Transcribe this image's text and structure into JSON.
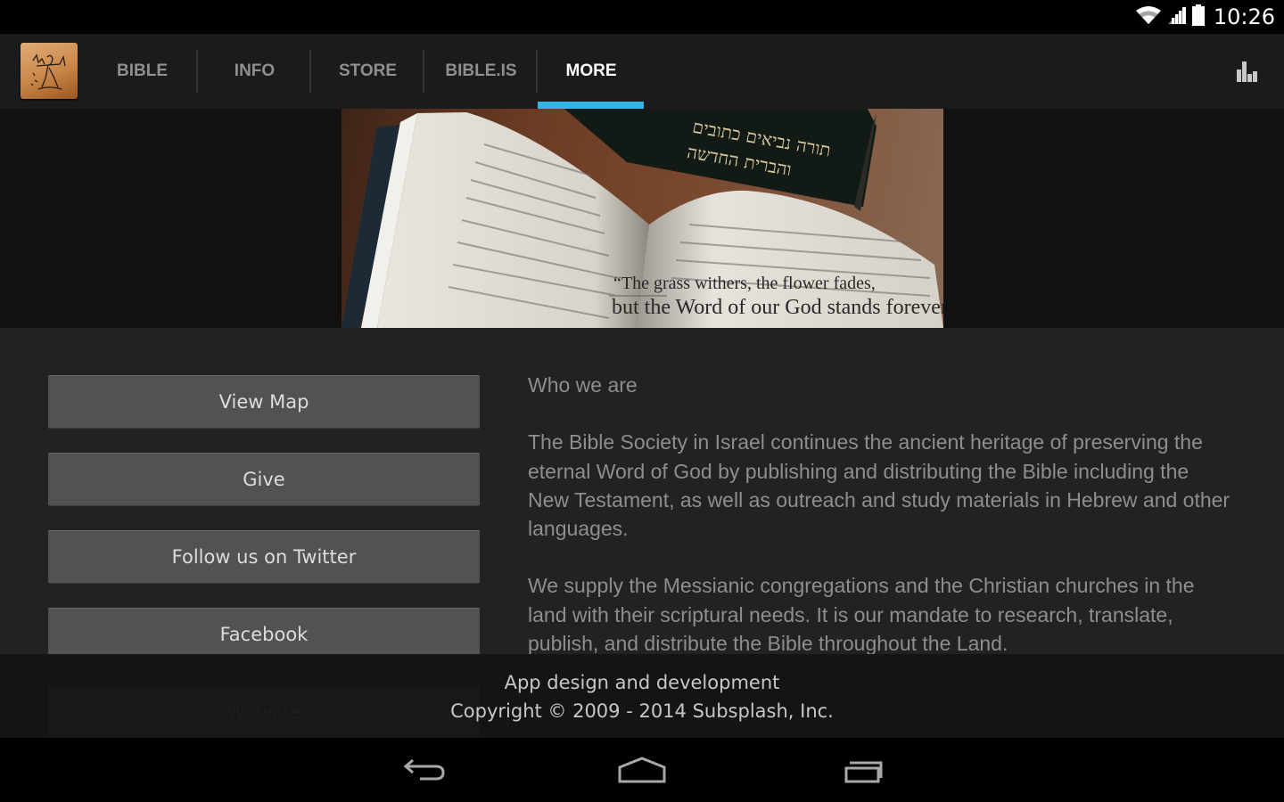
{
  "status_bar": {
    "time": "10:26",
    "icons": [
      "wifi-icon",
      "signal-icon",
      "battery-icon"
    ]
  },
  "action_bar": {
    "logo": "app-logo",
    "tabs": [
      {
        "label": "BIBLE",
        "active": false
      },
      {
        "label": "INFO",
        "active": false
      },
      {
        "label": "STORE",
        "active": false
      },
      {
        "label": "BIBLE.IS",
        "active": false
      },
      {
        "label": "MORE",
        "active": true
      }
    ],
    "accent_color": "#33b5e5",
    "right_icon": "bar-chart-icon"
  },
  "banner": {
    "hebrew_title_line1": "תורה נביאים כתובים",
    "hebrew_title_line2": "והברית החדשה",
    "quote_line1": "“The grass withers, the flower fades,",
    "quote_line2": "but the Word of our God stands forever”"
  },
  "buttons": [
    {
      "label": "View Map"
    },
    {
      "label": "Give"
    },
    {
      "label": "Follow us on Twitter"
    },
    {
      "label": "Facebook"
    },
    {
      "label": "Website"
    }
  ],
  "about": {
    "heading": "Who we are",
    "paragraphs": [
      "The Bible Society in Israel continues the ancient heritage of preserving the eternal Word of God by publishing and distributing the Bible including the New Testament, as well as outreach and study materials in Hebrew and other languages.",
      "We supply the Messianic congregations and the Christian churches in the land with their scriptural needs. It is our mandate to research, translate, publish, and distribute the Bible throughout the Land."
    ]
  },
  "footer": {
    "line1": "App design and development",
    "line2": "Copyright © 2009 - 2014 Subsplash, Inc."
  },
  "nav_bar": {
    "buttons": [
      "back-icon",
      "home-icon",
      "recent-apps-icon"
    ]
  }
}
